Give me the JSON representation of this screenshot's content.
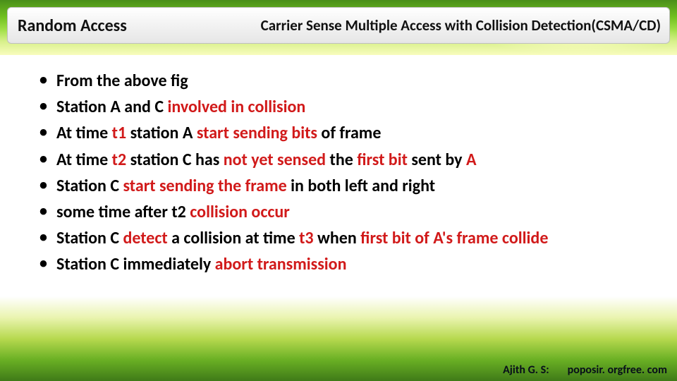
{
  "header": {
    "left": "Random Access",
    "right": "Carrier Sense Multiple Access  with Collision Detection(CSMA/CD)"
  },
  "bullets": {
    "0": {
      "a": "From the above fig"
    },
    "1": {
      "a": "Station A and C ",
      "b": "involved in collision"
    },
    "2": {
      "a": "At time ",
      "b": "t1 ",
      "c": "station A ",
      "d": "start sending bits ",
      "e": "of frame"
    },
    "3": {
      "a": "At time ",
      "b": "t2 ",
      "c": "station C has ",
      "d": "not yet sensed ",
      "e": "the ",
      "f": "first bit ",
      "g": "sent by ",
      "h": "A"
    },
    "4": {
      "a": "Station C ",
      "b": "start sending the frame ",
      "c": "in both left and right"
    },
    "5": {
      "a": " some time after t2 ",
      "b": "collision occur"
    },
    "6": {
      "a": "Station C ",
      "b": "detect ",
      "c": "a collision at time ",
      "d": "t3 ",
      "e": "when ",
      "f": "first bit of A's frame collide"
    },
    "7": {
      "a": "Station C immediately ",
      "b": "abort transmission"
    }
  },
  "footer": {
    "author": "Ajith G. S:",
    "url": "poposir. orgfree. com"
  }
}
